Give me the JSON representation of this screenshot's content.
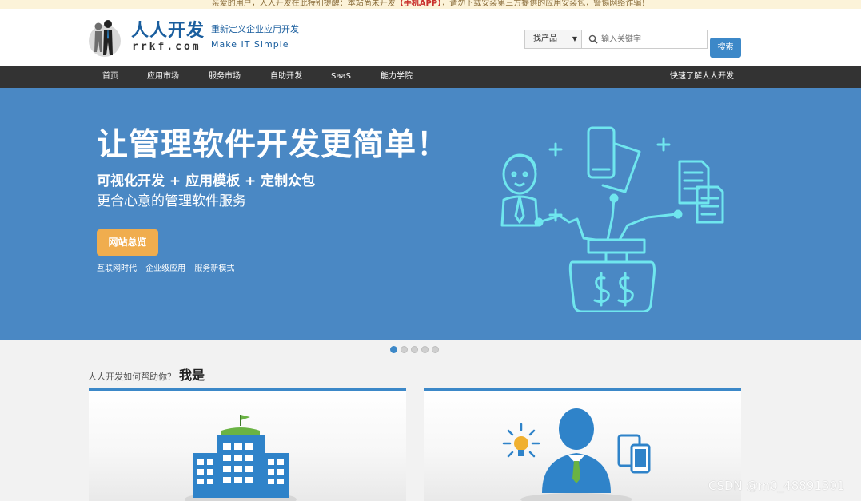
{
  "notice": {
    "before": "亲爱的用户，人人开发在此特别提醒：本站尚未开发",
    "highlight": "【手机APP】",
    "after": "，请勿下载安装第三方提供的应用安装包，警惕网络诈骗！"
  },
  "header": {
    "logo_title": "人人开发",
    "logo_domain": "rrkf.com",
    "slogan_cn": "重新定义企业应用开发",
    "slogan_en": "Make IT Simple"
  },
  "search": {
    "category": "找产品",
    "placeholder": "输入关键字",
    "button_label": "搜索"
  },
  "nav": {
    "items": [
      "首页",
      "应用市场",
      "服务市场",
      "自助开发",
      "SaaS",
      "能力学院"
    ],
    "right_link": "快速了解人人开发"
  },
  "banner": {
    "title": "让管理软件开发更简单！",
    "subtitle_1": "可视化开发 + 应用模板 + 定制众包",
    "subtitle_2": "更合心意的管理软件服务",
    "cta_label": "网站总览",
    "tags": [
      "互联网时代",
      "企业级应用",
      "服务新模式"
    ]
  },
  "carousel": {
    "count": 5,
    "active_index": 0
  },
  "section": {
    "heading_prefix": "人人开发如何帮助你？",
    "heading_strong": "我是"
  },
  "watermark": "CSDN @m0_48891301",
  "colors": {
    "brand_blue": "#3c88c8",
    "banner_bg": "#4a88c4",
    "nav_bg": "#333333",
    "cta_orange": "#f0ad4e",
    "illustration_cyan": "#6fe6ee",
    "notice_bg": "#fcf3d9"
  }
}
